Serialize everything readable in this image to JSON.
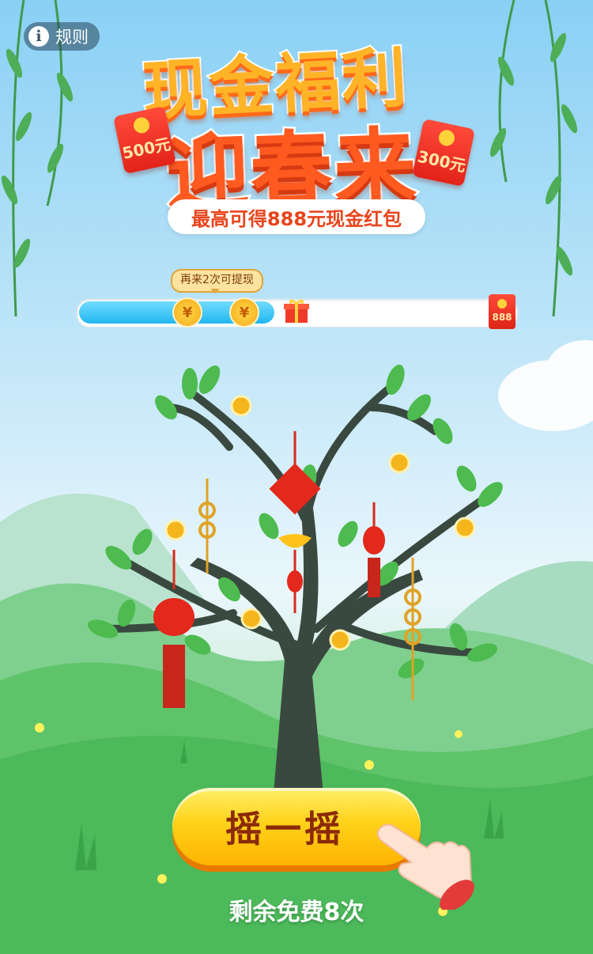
{
  "rules": {
    "label": "规则",
    "icon": "info-icon"
  },
  "title": {
    "line1": "现金福利",
    "line2": "迎春来",
    "subtitle": "最高可得888元现金红包"
  },
  "envelopes": {
    "left": "500元",
    "right": "300元"
  },
  "progress": {
    "tooltip": "再来2次可提现",
    "fill_fraction": 0.45,
    "coin_symbol": "¥",
    "reward_label": "888"
  },
  "shake": {
    "button_label": "摇一摇",
    "remaining_text": "剩余免费8次"
  },
  "colors": {
    "accent_red": "#e8451d",
    "button_yellow": "#ffd21a",
    "progress_blue": "#21b6f0",
    "grass_green": "#4cc14a"
  }
}
